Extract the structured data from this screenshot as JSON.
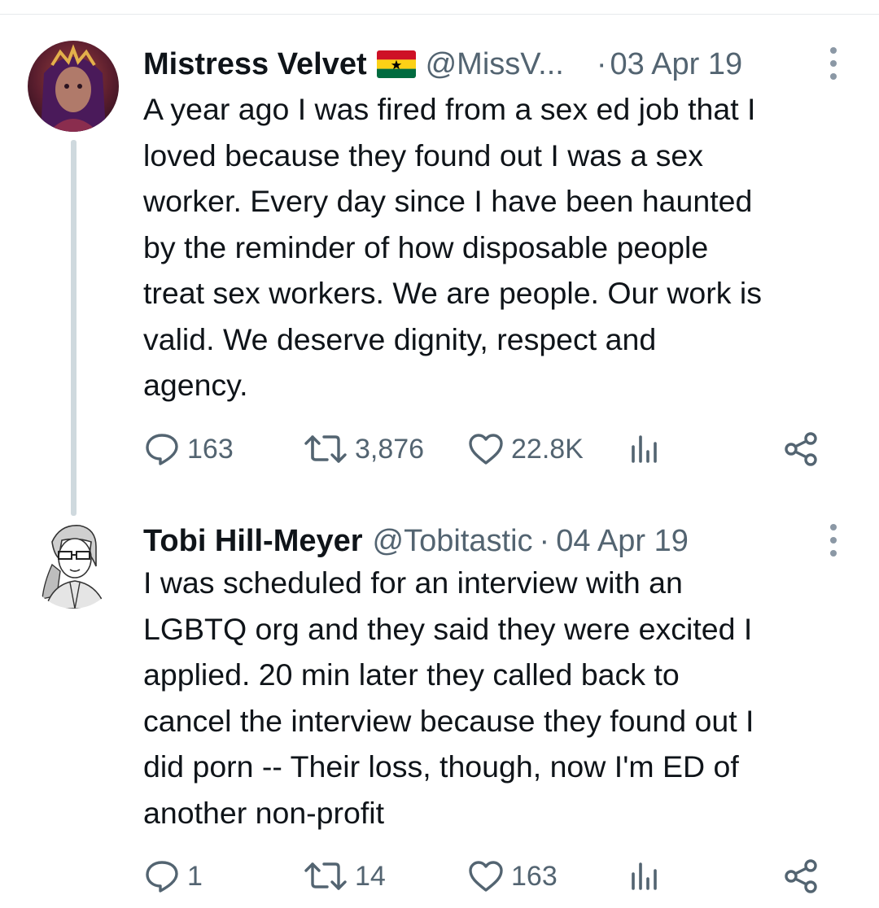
{
  "tweets": [
    {
      "name": "Mistress Velvet",
      "handle": "@MissV...",
      "separator": "·",
      "date": "03 Apr 19",
      "text": "A year ago I was fired from a sex ed job that I\nloved because they found out I was a sex\nworker. Every day since I have been haunted\nby the reminder of how disposable people\ntreat sex workers. We are people. Our work is\nvalid. We deserve dignity, respect and\nagency.",
      "replies": "163",
      "retweets": "3,876",
      "likes": "22.8K",
      "avatar_icon": "avatar-photo-icon",
      "flag_icon": "ghana-flag-icon"
    },
    {
      "name": "Tobi Hill-Meyer",
      "handle": "@Tobitastic",
      "separator": "·",
      "date": "04 Apr 19",
      "text": "I was scheduled for an interview with an\nLGBTQ org and they said they were excited I\napplied. 20 min later they called back to\ncancel the interview because they found out I\ndid porn -- Their loss, though, now I'm ED of\nanother non-profit",
      "replies": "1",
      "retweets": "14",
      "likes": "163",
      "avatar_icon": "avatar-sketch-icon"
    }
  ],
  "colors": {
    "text": "#0f1419",
    "muted": "#536471",
    "thread_line": "#cfd9de",
    "divider": "#e6e9ec"
  },
  "icons": [
    "reply-icon",
    "retweet-icon",
    "like-icon",
    "views-icon",
    "share-icon",
    "more-icon"
  ]
}
